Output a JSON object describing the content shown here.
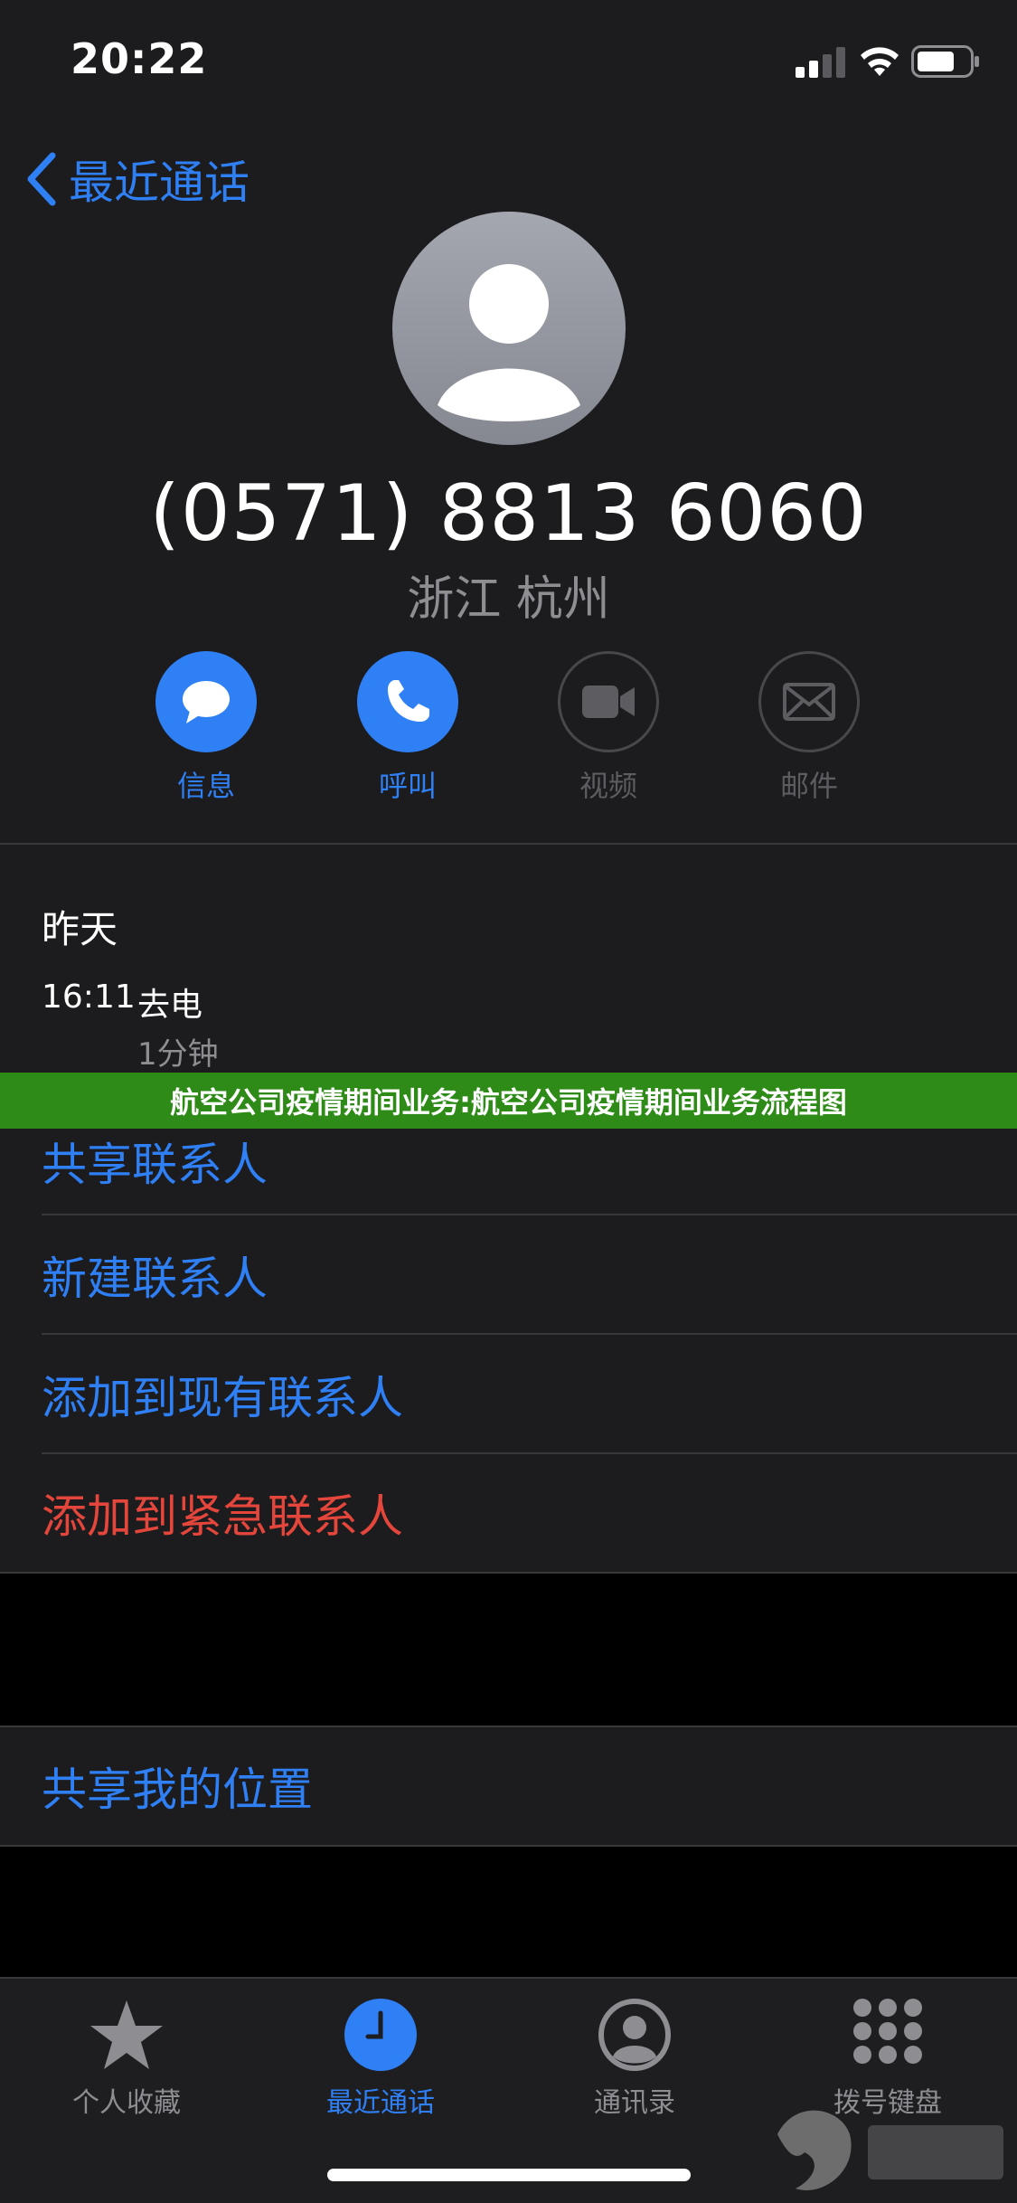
{
  "status_bar": {
    "time": "20:22"
  },
  "header": {
    "back_label": "最近通话"
  },
  "contact": {
    "phone_number": "(0571) 8813 6060",
    "location": "浙江 杭州"
  },
  "actions": [
    {
      "label": "信息",
      "icon": "message-icon",
      "enabled": true
    },
    {
      "label": "呼叫",
      "icon": "phone-icon",
      "enabled": true
    },
    {
      "label": "视频",
      "icon": "video-icon",
      "enabled": false
    },
    {
      "label": "邮件",
      "icon": "mail-icon",
      "enabled": false
    }
  ],
  "history": {
    "date": "昨天",
    "time": "16:11",
    "type": "去电",
    "duration": "1分钟"
  },
  "banner": {
    "text": "航空公司疫情期间业务:航空公司疫情期间业务流程图"
  },
  "menu": {
    "share_contact": "共享联系人",
    "new_contact": "新建联系人",
    "add_existing": "添加到现有联系人",
    "add_emergency": "添加到紧急联系人",
    "share_location": "共享我的位置"
  },
  "tabs": [
    {
      "label": "个人收藏",
      "icon": "star-icon",
      "active": false
    },
    {
      "label": "最近通话",
      "icon": "clock-icon",
      "active": true
    },
    {
      "label": "通讯录",
      "icon": "contacts-icon",
      "active": false
    },
    {
      "label": "拨号键盘",
      "icon": "keypad-icon",
      "active": false
    }
  ],
  "colors": {
    "accent": "#2f7ff5",
    "danger": "#e5463c",
    "banner": "#2e8b17",
    "background": "#1c1c1e"
  }
}
